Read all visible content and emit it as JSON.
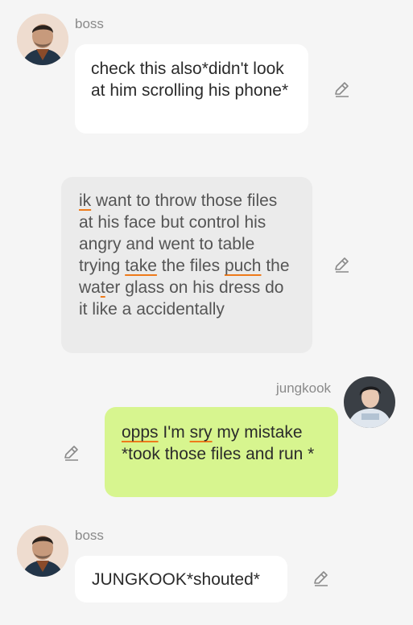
{
  "messages": [
    {
      "sender": "boss",
      "segments": [
        {
          "text": "check this also*didn't look at him scrolling his phone*",
          "underline": false
        }
      ]
    },
    {
      "sender": "",
      "segments": [
        {
          "text": "ik",
          "underline": true
        },
        {
          "text": " want to throw those files at his face but control his angry and went to table trying ",
          "underline": false
        },
        {
          "text": "take",
          "underline": true
        },
        {
          "text": " the files ",
          "underline": false
        },
        {
          "text": "puch",
          "underline": true
        },
        {
          "text": " the wa",
          "underline": false
        },
        {
          "text": "t",
          "underline": true
        },
        {
          "text": "er glass on his dress do it like a accidentally",
          "underline": false
        }
      ]
    },
    {
      "sender": "jungkook",
      "segments": [
        {
          "text": "opps",
          "underline": true
        },
        {
          "text": " I'm ",
          "underline": false
        },
        {
          "text": "sry",
          "underline": true
        },
        {
          "text": " my mistake *took those files and run *",
          "underline": false
        }
      ]
    },
    {
      "sender": "boss",
      "segments": [
        {
          "text": "JUNGKOOK*shouted*",
          "underline": false
        }
      ]
    }
  ],
  "icons": {
    "edit": "pencil-icon",
    "avatar_boss": "boss-avatar",
    "avatar_jungkook": "jungkook-avatar"
  },
  "colors": {
    "background": "#f5f5f5",
    "left_bubble": "#ffffff",
    "narration_bubble": "#ebebeb",
    "right_bubble": "#d7f58f",
    "typo_underline": "#ee7a1a"
  }
}
